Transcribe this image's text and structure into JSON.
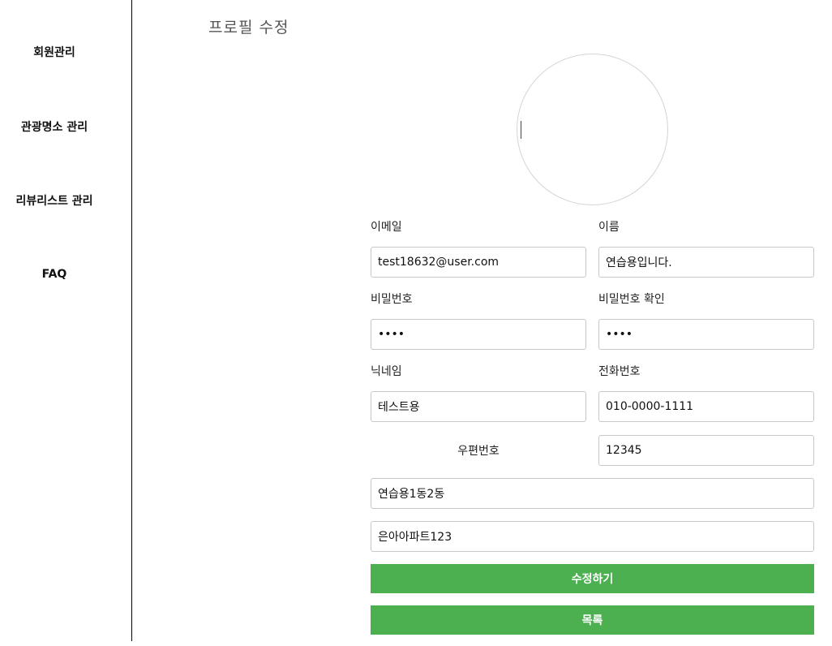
{
  "sidebar": {
    "items": [
      {
        "label": "회원관리"
      },
      {
        "label": "관광명소 관리"
      },
      {
        "label": "리뷰리스트 관리"
      },
      {
        "label": "FAQ"
      }
    ]
  },
  "main": {
    "title": "프로필 수정"
  },
  "form": {
    "email_label": "이메일",
    "email_value": "test18632@user.com",
    "name_label": "이름",
    "name_value": "연습용입니다.",
    "password_label": "비밀번호",
    "password_value": "••••",
    "password_confirm_label": "비밀번호 확인",
    "password_confirm_value": "••••",
    "nickname_label": "닉네임",
    "nickname_value": "테스트용",
    "phone_label": "전화번호",
    "phone_value": "010-0000-1111",
    "zipcode_label": "우편번호",
    "zipcode_value": "12345",
    "address1_value": "연습용1동2동",
    "address2_value": "은아아파트123"
  },
  "buttons": {
    "submit_label": "수정하기",
    "list_label": "목록"
  },
  "colors": {
    "accent": "#4caf50"
  }
}
